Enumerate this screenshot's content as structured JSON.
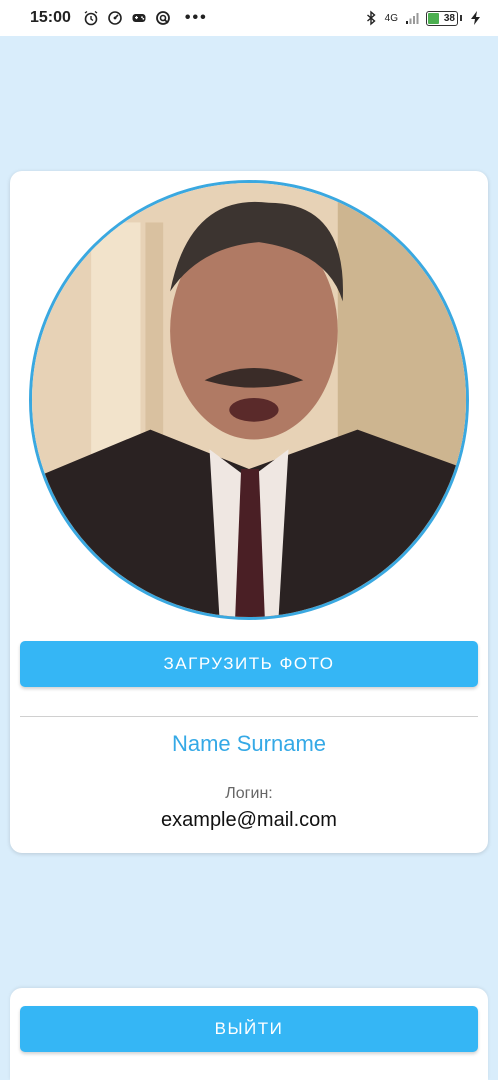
{
  "status_bar": {
    "time": "15:00",
    "icons": [
      "alarm-icon",
      "speedometer-icon",
      "game-icon",
      "vpn-icon"
    ],
    "overflow": "•••",
    "network": "4G",
    "battery": "38",
    "battery_level": 0.38
  },
  "profile": {
    "upload_button_label": "ЗАГРУЗИТЬ ФОТО",
    "full_name": "Name Surname",
    "login_label": "Логин:",
    "login_value": "example@mail.com"
  },
  "footer": {
    "logout_button_label": "ВЫЙТИ"
  },
  "colors": {
    "background": "#d9edfb",
    "accent": "#35b6f5",
    "name_text": "#35a9e6",
    "avatar_border": "#3aa8e0"
  }
}
